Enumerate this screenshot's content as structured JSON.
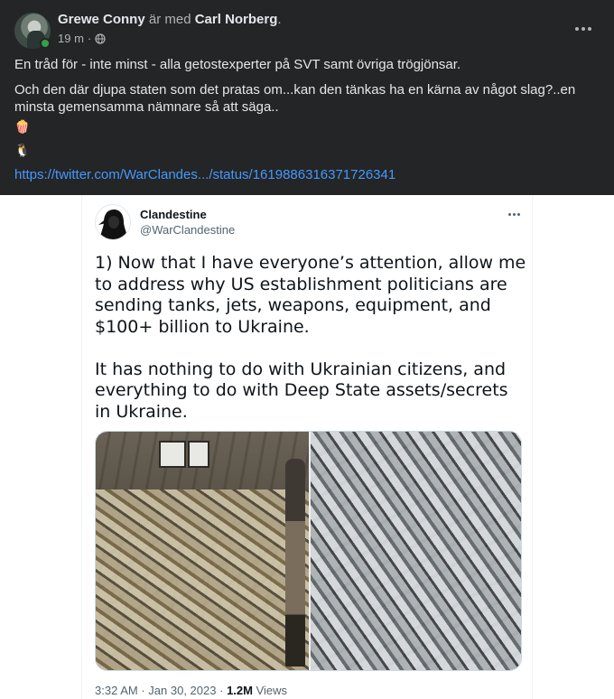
{
  "facebook_post": {
    "author": "Grewe Conny",
    "with_text": "är med",
    "tagged": "Carl Norberg",
    "tagged_suffix": ".",
    "time": "19 m",
    "time_separator": "·",
    "audience_icon": "globe-icon",
    "paragraph1": "En tråd för - inte minst - alla getostexperter på SVT samt övriga trögjönsar.",
    "paragraph2": "Och den där djupa staten som det pratas om...kan den tänkas ha en kärna av något slag?..en minsta gemensamma nämnare så att säga..",
    "emoji1": "🍿",
    "emoji2": "🐧",
    "link": "https://twitter.com/WarClandes.../status/1619886316371726341"
  },
  "tweet": {
    "name": "Clandestine",
    "handle": "@WarClandestine",
    "text": "1) Now that I have everyone’s attention, allow me to address why US establishment politicians are sending tanks, jets, weapons, equipment, and $100+ billion to Ukraine.\n\nIt has nothing to do with Ukrainian citizens, and everything to do with Deep State assets/secrets in Ukraine.",
    "time": "3:32 AM",
    "dot": "·",
    "date": "Jan 30, 2023",
    "dot2": "·",
    "views_count": "1.2M",
    "views_label": "Views"
  },
  "colors": {
    "fb_background": "#242526",
    "fb_link": "#4599ff",
    "online_dot": "#31a24c",
    "tweet_text": "#0f1419",
    "tweet_muted": "#536471"
  }
}
